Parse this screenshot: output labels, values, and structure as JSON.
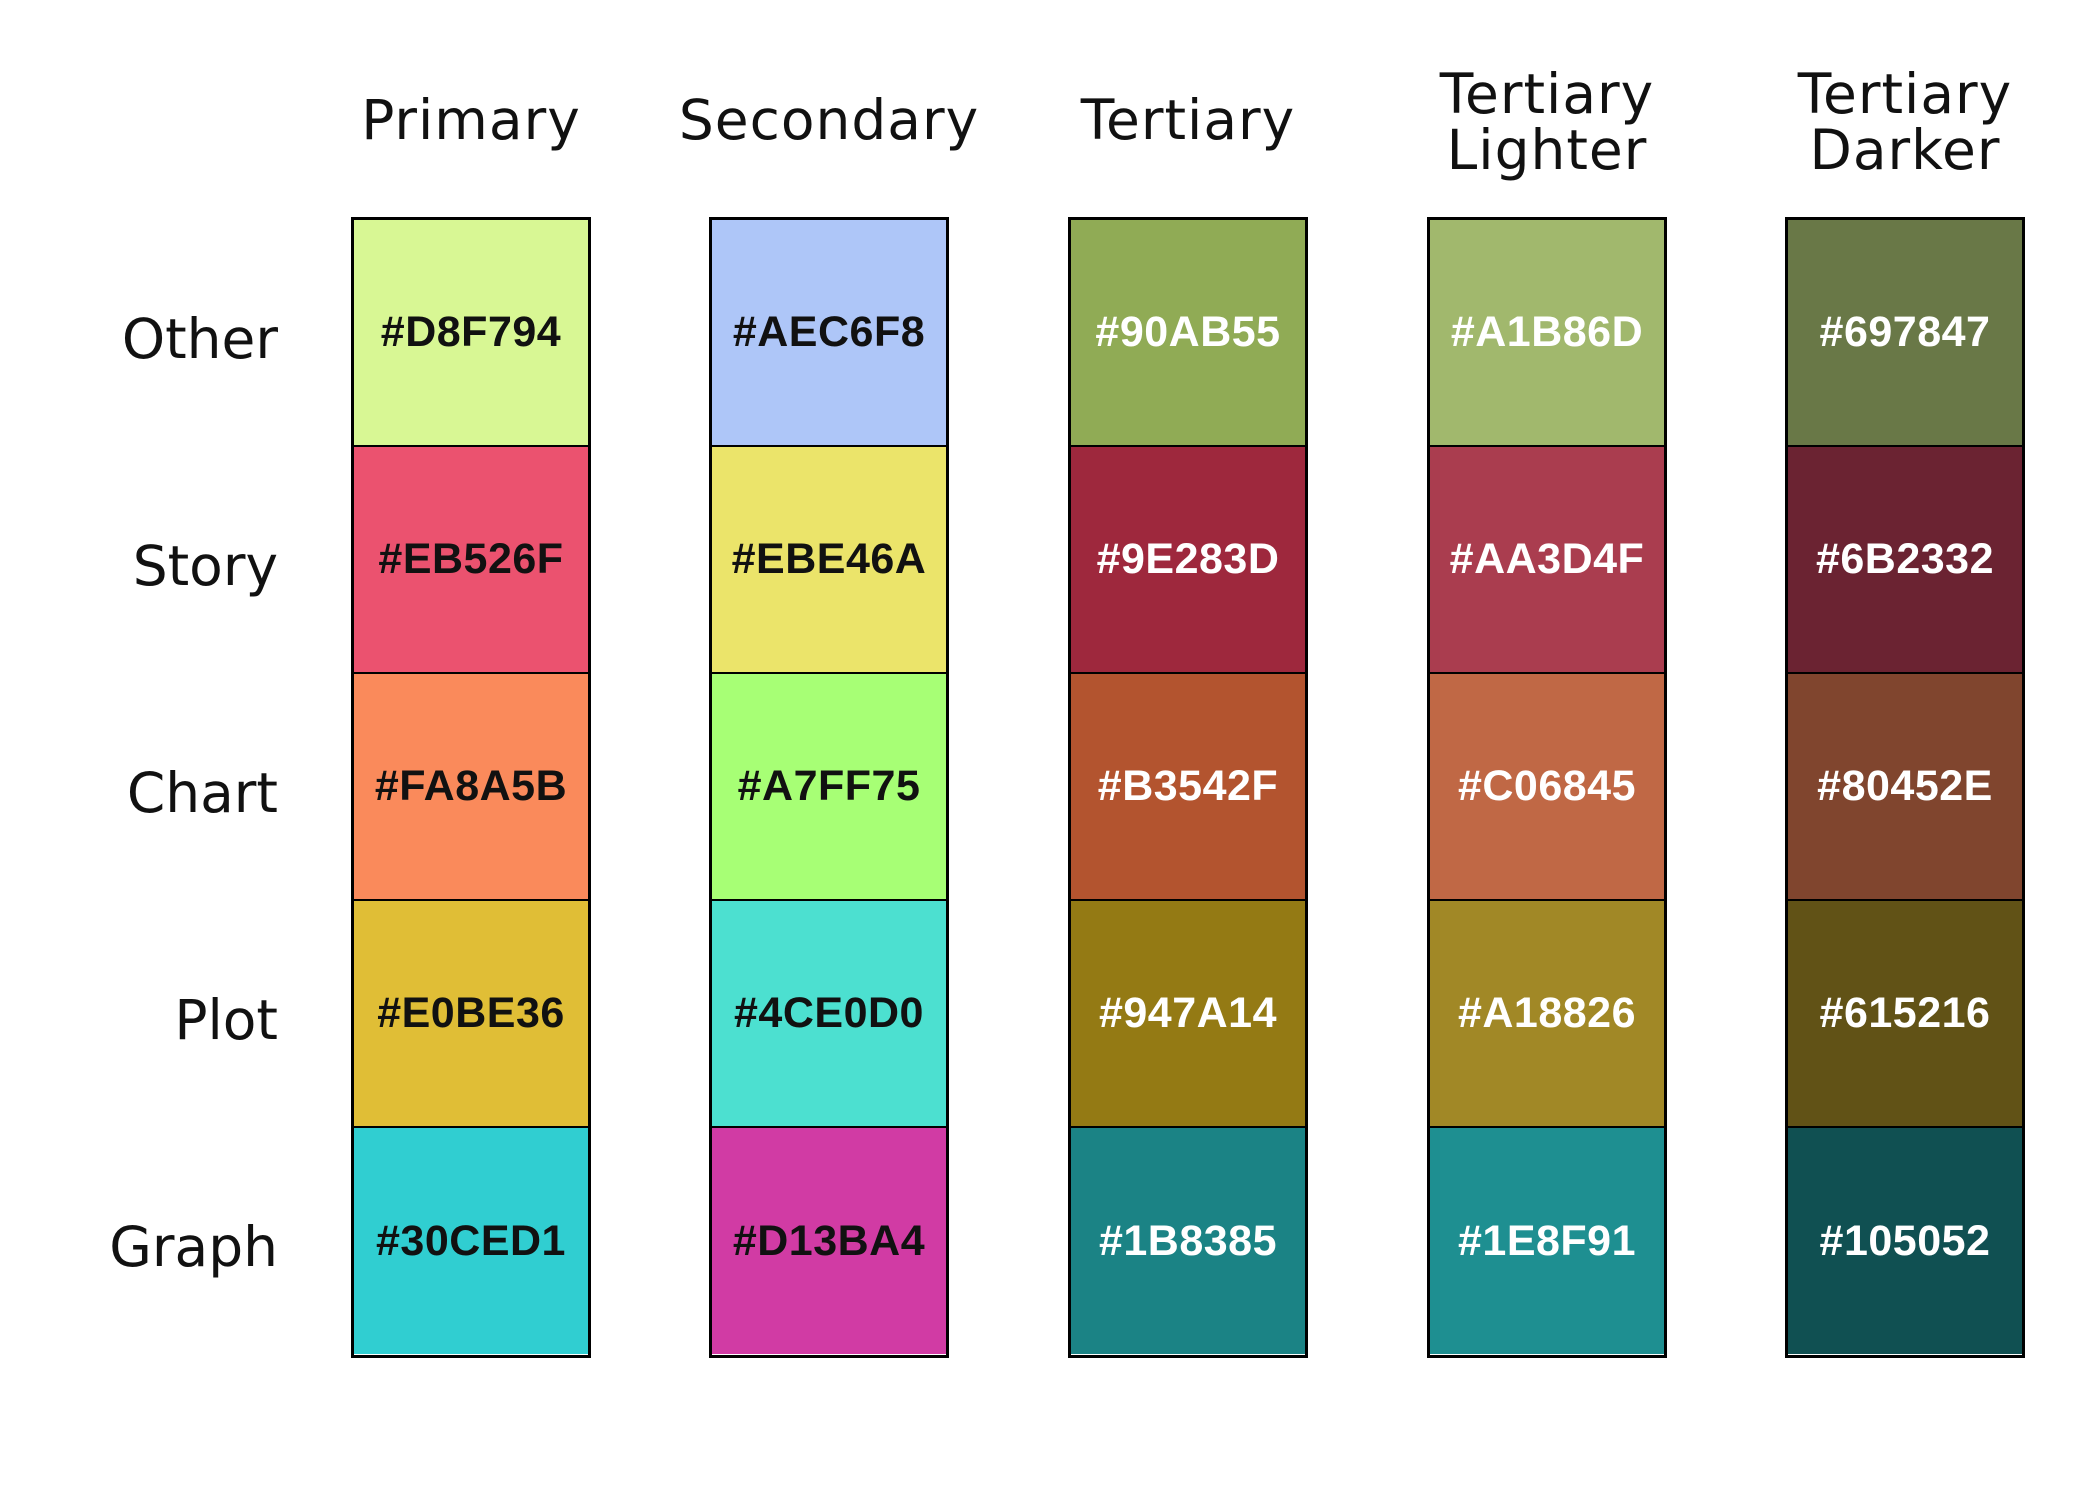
{
  "columns": [
    {
      "title": "Primary",
      "title_lines": [
        "Primary"
      ],
      "text_color": "#111111",
      "swatches": [
        "#D8F794",
        "#EB526F",
        "#FA8A5B",
        "#E0BE36",
        "#30CED1"
      ]
    },
    {
      "title": "Secondary",
      "title_lines": [
        "Secondary"
      ],
      "text_color": "#111111",
      "swatches": [
        "#AEC6F8",
        "#EBE46A",
        "#A7FF75",
        "#4CE0D0",
        "#D13BA4"
      ]
    },
    {
      "title": "Tertiary",
      "title_lines": [
        "Tertiary"
      ],
      "text_color": "#ffffff",
      "swatches": [
        "#90AB55",
        "#9E283D",
        "#B3542F",
        "#947A14",
        "#1B8385"
      ]
    },
    {
      "title": "Tertiary Lighter",
      "title_lines": [
        "Tertiary",
        "Lighter"
      ],
      "text_color": "#ffffff",
      "swatches": [
        "#A1B86D",
        "#AA3D4F",
        "#C06845",
        "#A18826",
        "#1E8F91"
      ]
    },
    {
      "title": "Tertiary Darker",
      "title_lines": [
        "Tertiary",
        "Darker"
      ],
      "text_color": "#ffffff",
      "swatches": [
        "#697847",
        "#6B2332",
        "#80452E",
        "#615216",
        "#105052"
      ]
    }
  ],
  "rows": [
    "Other",
    "Story",
    "Chart",
    "Plot",
    "Graph"
  ]
}
